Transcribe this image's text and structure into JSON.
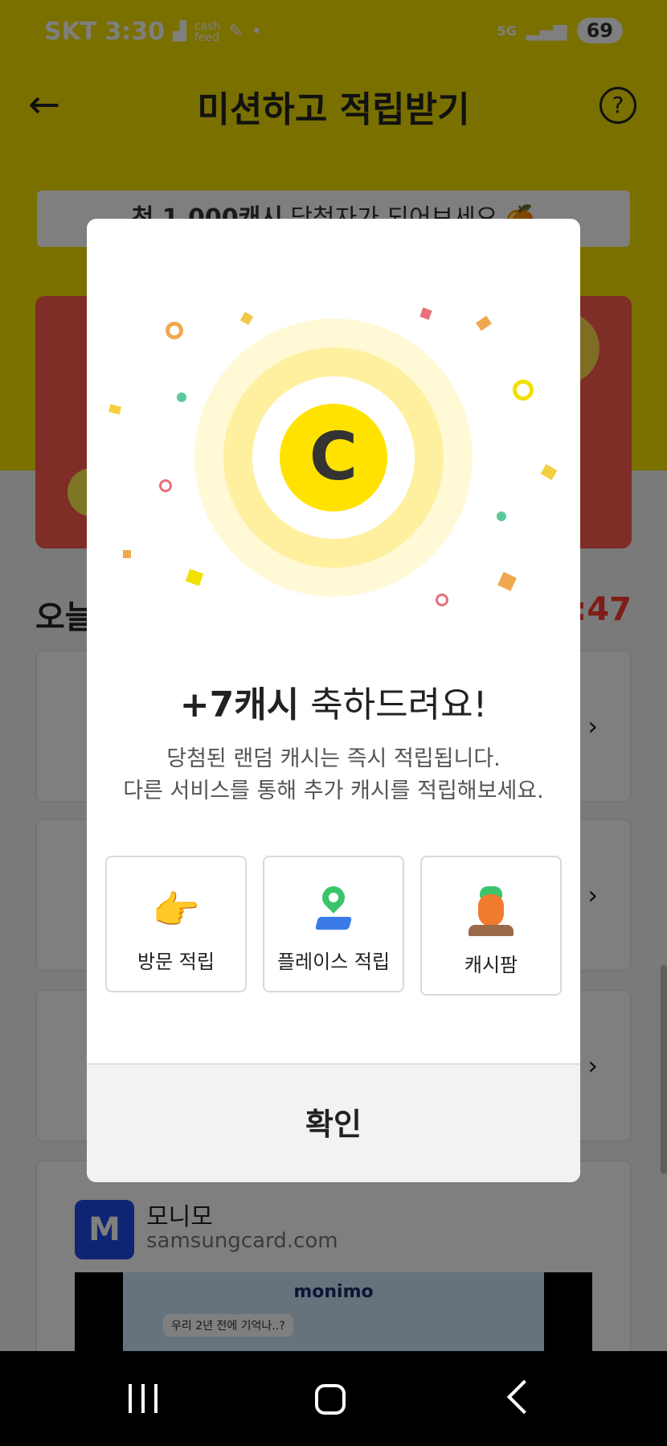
{
  "status_bar": {
    "carrier": "SKT",
    "time": "3:30",
    "notif_icons": [
      "sort-icon",
      "cashfeed-icon",
      "bell-icon"
    ],
    "dot": "•",
    "network": "5G",
    "battery": "69"
  },
  "header": {
    "back": "←",
    "title": "미션하고 적립받기",
    "help": "?"
  },
  "promo_banner": {
    "bold": "천 1,000캐시",
    "rest": " 당첨자가 되어보세요 🍊"
  },
  "section": {
    "title_prefix": "오늘",
    "timer_suffix": ":47"
  },
  "monimo": {
    "logo_letter": "M",
    "name": "모니모",
    "url": "samsungcard.com",
    "preview_brand": "monimo",
    "preview_chat": "우리 2년 전에 기억나..?"
  },
  "modal": {
    "coin_letter": "C",
    "headline_amount": "+7캐시",
    "headline_rest": " 축하드려요!",
    "desc_line1": "당첨된 랜덤 캐시는 즉시 적립됩니다.",
    "desc_line2": "다른 서비스를 통해 추가 캐시를 적립해보세요.",
    "options": [
      {
        "label": "방문 적립",
        "icon": "pointing-hand-icon",
        "glyph": "👉"
      },
      {
        "label": "플레이스 적립",
        "icon": "map-pin-icon"
      },
      {
        "label": "캐시팜",
        "icon": "carrot-icon"
      }
    ],
    "confirm": "확인"
  },
  "colors": {
    "brand_yellow": "#f2e000",
    "coin_yellow": "#ffe200",
    "accent_red": "#ff3b30"
  }
}
